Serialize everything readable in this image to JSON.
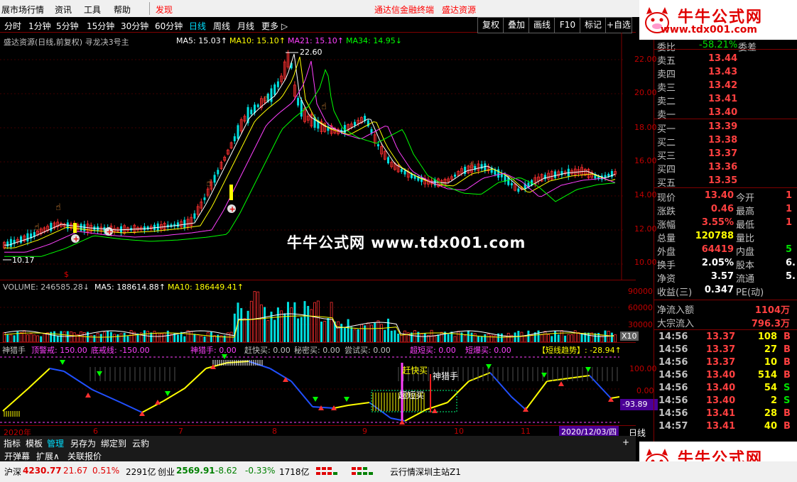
{
  "menubar": {
    "items": [
      "展市场行情",
      "资讯",
      "工具",
      "帮助"
    ],
    "alert": "发现",
    "center_links": [
      "通达信金融终端",
      "盛达资源"
    ]
  },
  "watermark": {
    "title": "牛牛公式网",
    "url": "www.tdx001.com",
    "center": "牛牛公式网 www.tdx001.com"
  },
  "periods": [
    "分时",
    "1分钟",
    "5分钟",
    "15分钟",
    "30分钟",
    "60分钟",
    "日线",
    "周线",
    "月线",
    "更多 ▷"
  ],
  "active_period": "日线",
  "toolbar": [
    "复权",
    "叠加",
    "画线",
    "F10",
    "标记",
    "+自选"
  ],
  "main_chart": {
    "title": "盛达资源(日线,前复权) 寻龙决3号主",
    "ma5": "MA5: 15.03↑",
    "ma10": "MA10: 15.10↑",
    "ma21": "MA21: 15.10↑",
    "ma34": "MA34: 14.95↓",
    "high_label": "22.60",
    "low_label": "10.17",
    "y_ticks": [
      "22.00",
      "20.00",
      "18.00",
      "16.00",
      "14.00",
      "12.00",
      "10.00"
    ]
  },
  "volume_chart": {
    "volume": "VOLUME: 246585.28↓",
    "ma5": "MA5: 188614.88↑",
    "ma10": "MA10: 186449.41↑",
    "y_ticks": [
      "90000",
      "60000",
      "30000"
    ],
    "unit": "X10"
  },
  "indicator": {
    "labels": [
      {
        "text": "神猎手",
        "color": "#c0c0c0"
      },
      {
        "text": "顶警戒: 150.00",
        "color": "#ff40ff"
      },
      {
        "text": "底戒线: -150.00",
        "color": "#ff40ff"
      },
      {
        "text": "神猎手: 0.00",
        "color": "#ff40ff"
      },
      {
        "text": "赶快买: 0.00",
        "color": "#c0c0c0"
      },
      {
        "text": "秘密买: 0.00",
        "color": "#c0c0c0"
      },
      {
        "text": "尝试买: 0.00",
        "color": "#c0c0c0"
      },
      {
        "text": "超短买: 0.00",
        "color": "#ff40ff"
      },
      {
        "text": "短爆买: 0.00",
        "color": "#ff40ff"
      },
      {
        "text": "【短线趋势】: -28.94↑",
        "color": "#ffff00"
      }
    ],
    "y_ticks": [
      "100.00",
      "0.00"
    ],
    "current_value": "-93.89",
    "annotations": [
      "赶快买",
      "神猎手",
      "超短买"
    ]
  },
  "date_axis": {
    "labels": [
      "2020年",
      "6",
      "7",
      "8",
      "9",
      "10",
      "11"
    ],
    "current_date": "2020/12/03/四",
    "period_label": "日线"
  },
  "bottom_tabs_row1": [
    "指标",
    "模板",
    "管理",
    "另存为",
    "绑定到",
    "云豹"
  ],
  "bottom_tabs_row2": [
    "开弹幕",
    "扩展∧",
    "关联报价"
  ],
  "quote": {
    "ratio_label": "委比",
    "ratio_value": "-58.21%",
    "diff_label": "委差",
    "sells": [
      {
        "label": "卖五",
        "price": "13.44"
      },
      {
        "label": "卖四",
        "price": "13.43"
      },
      {
        "label": "卖三",
        "price": "13.42"
      },
      {
        "label": "卖二",
        "price": "13.41"
      },
      {
        "label": "卖一",
        "price": "13.40"
      }
    ],
    "buys": [
      {
        "label": "买一",
        "price": "13.39"
      },
      {
        "label": "买二",
        "price": "13.38"
      },
      {
        "label": "买三",
        "price": "13.37"
      },
      {
        "label": "买四",
        "price": "13.36"
      },
      {
        "label": "买五",
        "price": "13.35"
      }
    ],
    "stats": [
      {
        "l1": "现价",
        "v1": "13.40",
        "c1": "#ff4040",
        "l2": "今开",
        "v2": "1",
        "c2": "#ff4040"
      },
      {
        "l1": "涨跌",
        "v1": "0.46",
        "c1": "#ff4040",
        "l2": "最高",
        "v2": "1",
        "c2": "#ff4040"
      },
      {
        "l1": "涨幅",
        "v1": "3.55%",
        "c1": "#ff4040",
        "l2": "最低",
        "v2": "1",
        "c2": "#ff4040"
      },
      {
        "l1": "总量",
        "v1": "120788",
        "c1": "#ffff00",
        "l2": "量比",
        "v2": "",
        "c2": "#ffff00"
      },
      {
        "l1": "外盘",
        "v1": "64419",
        "c1": "#ff4040",
        "l2": "内盘",
        "v2": "5",
        "c2": "#00e000"
      },
      {
        "l1": "换手",
        "v1": "2.05%",
        "c1": "#ffffff",
        "l2": "股本",
        "v2": "6.",
        "c2": "#ffffff"
      },
      {
        "l1": "净资",
        "v1": "3.57",
        "c1": "#ffffff",
        "l2": "流通",
        "v2": "5.",
        "c2": "#ffffff"
      },
      {
        "l1": "收益(三)",
        "v1": "0.347",
        "c1": "#ffffff",
        "l2": "PE(动)",
        "v2": "",
        "c2": "#ffffff"
      }
    ],
    "flows": [
      {
        "label": "净流入额",
        "value": "1104万"
      },
      {
        "label": "大宗流入",
        "value": "796.3万"
      }
    ],
    "ticks": [
      {
        "time": "14:56",
        "price": "13.37",
        "vol": "108",
        "side": "B"
      },
      {
        "time": "14:56",
        "price": "13.37",
        "vol": "27",
        "side": "B"
      },
      {
        "time": "14:56",
        "price": "13.37",
        "vol": "10",
        "side": "B"
      },
      {
        "time": "14:56",
        "price": "13.40",
        "vol": "514",
        "side": "B"
      },
      {
        "time": "14:56",
        "price": "13.40",
        "vol": "54",
        "side": "S"
      },
      {
        "time": "14:56",
        "price": "13.40",
        "vol": "2",
        "side": "S"
      },
      {
        "time": "14:56",
        "price": "13.41",
        "vol": "28",
        "side": "B"
      },
      {
        "time": "14:57",
        "price": "13.41",
        "vol": "40",
        "side": "B"
      }
    ]
  },
  "statusbar": {
    "index1_name": "沪深",
    "index1_value": "4230.77",
    "index1_chg": "21.67",
    "index1_pct": "0.51%",
    "index1_amt": "2291亿",
    "index2_name": "创业",
    "index2_value": "2569.91",
    "index2_chg": "-8.62",
    "index2_pct": "-0.33%",
    "index2_amt": "1718亿",
    "server": "云行情深圳主站Z1"
  }
}
